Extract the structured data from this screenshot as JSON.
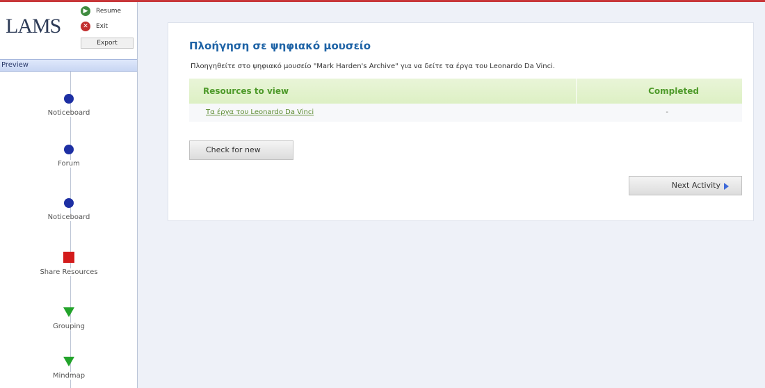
{
  "app": {
    "logo_text": "LAMS",
    "controls": {
      "resume": "Resume",
      "exit": "Exit",
      "export": "Export"
    },
    "preview_label": "Preview"
  },
  "sequence": {
    "activities": [
      {
        "label": "Noticeboard",
        "shape": "circle"
      },
      {
        "label": "Forum",
        "shape": "circle"
      },
      {
        "label": "Noticeboard",
        "shape": "circle"
      },
      {
        "label": "Share Resources",
        "shape": "square"
      },
      {
        "label": "Grouping",
        "shape": "triangle"
      },
      {
        "label": "Mindmap",
        "shape": "triangle"
      }
    ]
  },
  "main": {
    "title": "Πλοήγηση σε ψηφιακό μουσείο",
    "description": "Πλοηγηθείτε στο ψηφιακό μουσείο \"Mark Harden's Archive\" για να δείτε τα έργα του Leonardo Da Vinci.",
    "table": {
      "headers": [
        "Resources to view",
        "Completed"
      ],
      "rows": [
        {
          "resource": "Τα έργα του Leonardo Da Vinci",
          "completed": "-"
        }
      ]
    },
    "check_button": "Check for new",
    "next_button": "Next Activity"
  },
  "colors": {
    "accent_border": "#c8373a",
    "title_blue": "#1e63a6",
    "header_green": "#4e9a2a",
    "circle_blue": "#1d2fa3",
    "square_red": "#d31b1b",
    "triangle_green": "#22a32a"
  }
}
